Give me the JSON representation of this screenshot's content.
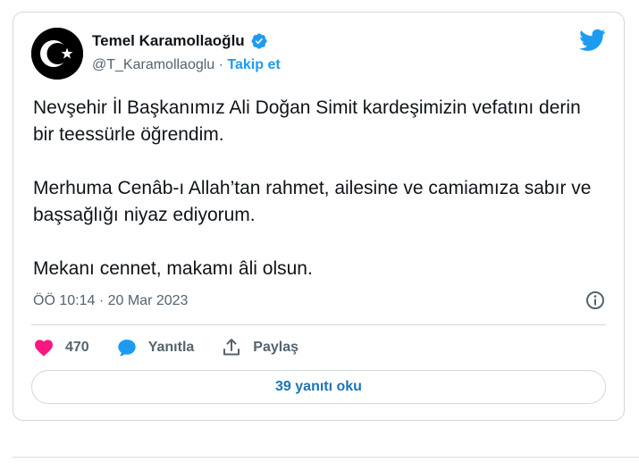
{
  "author": {
    "name": "Temel Karamollaoğlu",
    "handle": "@T_Karamollaoglu",
    "separator": " · ",
    "follow_label": "Takip et"
  },
  "icons": {
    "avatar": "crescent-star-avatar",
    "verified": "verified-badge-icon",
    "brand": "twitter-bird-icon",
    "info": "info-icon",
    "like": "heart-icon",
    "reply": "speech-bubble-icon",
    "share": "share-upload-icon"
  },
  "colors": {
    "accent": "#1d9bf0",
    "like": "#f91880",
    "muted_text": "#536471",
    "border": "#cfd9de"
  },
  "tweet": {
    "paragraphs": [
      "Nevşehir İl Başkanımız Ali Doğan Simit kardeşimizin vefatını derin bir teessürle öğrendim.",
      "Merhuma Cenâb-ı Allah’tan rahmet, ailesine ve camiamıza sabır ve başsağlığı niyaz ediyorum.",
      "Mekanı cennet, makamı âli olsun."
    ],
    "timestamp": "ÖÖ 10:14 · 20 Mar 2023"
  },
  "actions": {
    "likes_count": "470",
    "reply_label": "Yanıtla",
    "share_label": "Paylaş"
  },
  "replies_button_label": "39 yanıtı oku"
}
